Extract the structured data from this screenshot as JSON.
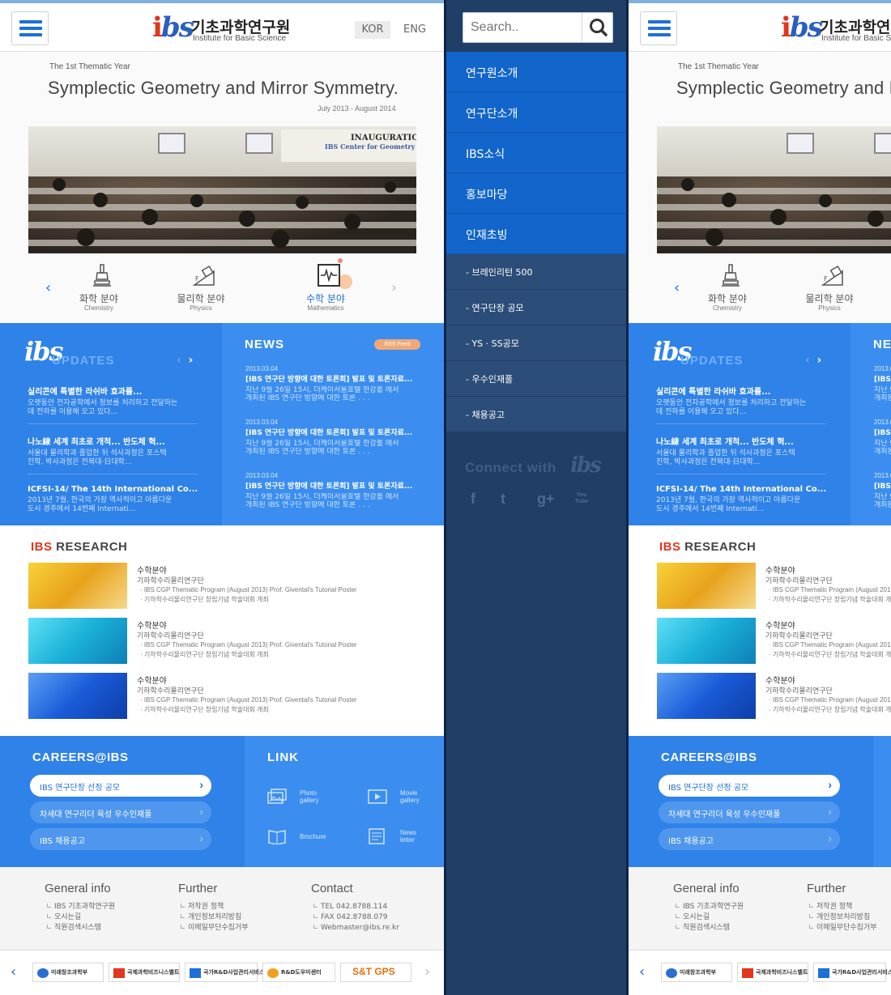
{
  "header": {
    "menu_label": "menu",
    "logo_mark": "ibs",
    "logo_ko": "기초과학연구원",
    "logo_en": "Institute for Basic Science",
    "langs": [
      "KOR",
      "ENG"
    ],
    "active_lang": "KOR"
  },
  "hero": {
    "subtitle": "The 1st Thematic Year",
    "title": "Symplectic Geometry and Mirror Symmetry.",
    "date": "July 2013 - August 2014",
    "photo_banner_1": "INAUGURATION",
    "photo_banner_2": "IBS Center for Geometry and"
  },
  "categories": [
    {
      "ko": "화학 분야",
      "en": "Chemistry",
      "icon": "flask-stand-icon",
      "active": false
    },
    {
      "ko": "물리학 분야",
      "en": "Physics",
      "icon": "physics-ramp-icon",
      "active": false
    },
    {
      "ko": "수학 분야",
      "en": "Mathematics",
      "icon": "math-wave-icon",
      "active": true
    }
  ],
  "updates": {
    "logo": "ibs",
    "title": "UPDATES",
    "items": [
      {
        "title": "실리콘에 특별한 라쉬바 효과를...",
        "desc1": "오랫동안 전자공학에서 정보를 처리하고 전달하는",
        "desc2": "데 전하를 이용해 오고 있다..."
      },
      {
        "title": "나노線 세계 최초로 개척... 반도체 혁...",
        "desc1": "서울대 물리학과 졸업한 뒤 석사과정은 포스텍",
        "desc2": "진학, 박사과정은 전북대·日대학..."
      },
      {
        "title": "ICFSI-14/ The 14th International Co...",
        "desc1": "2013년 7월, 한국의 가장 역사적이고 아름다운",
        "desc2": "도시 경주에서 14번째 Internati..."
      }
    ]
  },
  "news": {
    "title": "NEWS",
    "rss_label": "RSS Feed",
    "items": [
      {
        "date": "2013.03.04",
        "title": "[IBS 연구단 방향에 대한 토론회] 발표 및 토론자료...",
        "desc1": "지난 9월 26일 15시, 더케이서울호텔 한강홀 에서",
        "desc2": "개최된 IBS 연구단 방향에 대한 토론 . . ."
      },
      {
        "date": "2013.03.04",
        "title": "[IBS 연구단 방향에 대한 토론회] 발표 및 토론자료...",
        "desc1": "지난 9월 26일 15시, 더케이서울호텔 한강홀 에서",
        "desc2": "개최된 IBS 연구단 방향에 대한 토론 . . ."
      },
      {
        "date": "2013.03.04",
        "title": "[IBS 연구단 방향에 대한 토론회] 발표 및 토론자료...",
        "desc1": "지난 9월 26일 15시, 더케이서울호텔 한강홀 에서",
        "desc2": "개최된 IBS 연구단 방향에 대한 토론 . . ."
      }
    ]
  },
  "research": {
    "title_accent": "IBS",
    "title_rest": " RESEARCH",
    "items": [
      {
        "category": "수학분야",
        "center": "기하학수리물리연구단",
        "line1": "· IBS CGP Thematic Program (August 2013) Prof. Givental's Tutorial Poster",
        "line2": "· 기하학수리물리연구단 창립기념 학술대회 개최",
        "theme": "yellow",
        "color": "#e8a21c"
      },
      {
        "category": "수학분야",
        "center": "기하학수리물리연구단",
        "line1": "· IBS CGP Thematic Program (August 2013) Prof. Givental's Tutorial Poster",
        "line2": "· 기하학수리물리연구단 창립기념 학술대회 개최",
        "theme": "cyan",
        "color": "#1ab0d8"
      },
      {
        "category": "수학분야",
        "center": "기하학수리물리연구단",
        "line1": "· IBS CGP Thematic Program (August 2013) Prof. Givental's Tutorial Poster",
        "line2": "· 기하학수리물리연구단 창립기념 학술대회 개최",
        "theme": "blue",
        "color": "#1a5bd8"
      }
    ]
  },
  "careers": {
    "title": "CAREERS@IBS",
    "buttons": [
      {
        "label": "IBS 연구단장 선정 공모",
        "active": true
      },
      {
        "label": "차세대 연구리더 육성 우수인재풀",
        "active": false
      },
      {
        "label": "IBS  채용공고",
        "active": false
      }
    ]
  },
  "link": {
    "title": "LINK",
    "items": [
      {
        "label1": "Photo",
        "label2": "gallery",
        "icon": "photo-gallery-icon"
      },
      {
        "label1": "Movie",
        "label2": "gallery",
        "icon": "movie-gallery-icon"
      },
      {
        "label1": "Brochure",
        "label2": "",
        "icon": "brochure-icon"
      },
      {
        "label1": "News",
        "label2": "letter",
        "icon": "newsletter-icon"
      }
    ]
  },
  "footer": {
    "general": {
      "title": "General info",
      "items": [
        "IBS 기초과학연구원",
        "오시는길",
        "직원검색시스템"
      ]
    },
    "further": {
      "title": "Further",
      "items": [
        "저작권 정책",
        "개인정보처리방침",
        "이메일무단수집거부"
      ]
    },
    "contact": {
      "title": "Contact",
      "items": [
        "TEL  042.8788.114",
        "FAX  042.8788.079",
        "Webmaster@ibs.re.kr"
      ]
    }
  },
  "partners": [
    "미래창조과학부",
    "국제과학비즈니스벨트",
    "국가R&D사업관리서비스",
    "R&D도우미센터",
    "S&T GPS"
  ],
  "menu": {
    "search_placeholder": "Search..",
    "main_items": [
      "연구원소개",
      "연구단소개",
      "IBS소식",
      "홍보마당",
      "인재초빙"
    ],
    "sub_items": [
      "- 브레인리턴 500",
      "- 연구단장 공모",
      "- YS · SS공모",
      "- 우수인재풀",
      "- 채용공고"
    ],
    "connect_text": "Connect with",
    "connect_logo": "ibs",
    "social": [
      "facebook-icon",
      "twitter-icon",
      "google-plus-icon",
      "youtube-icon"
    ],
    "social_labels": [
      "f",
      "t",
      "g+",
      "You Tube"
    ]
  },
  "colors": {
    "brand_blue": "#1f6fd6",
    "brand_red": "#e0371d",
    "panel_blue": "#2f82e8",
    "menu_navy": "#203e66",
    "menu_main": "#1265ca"
  }
}
